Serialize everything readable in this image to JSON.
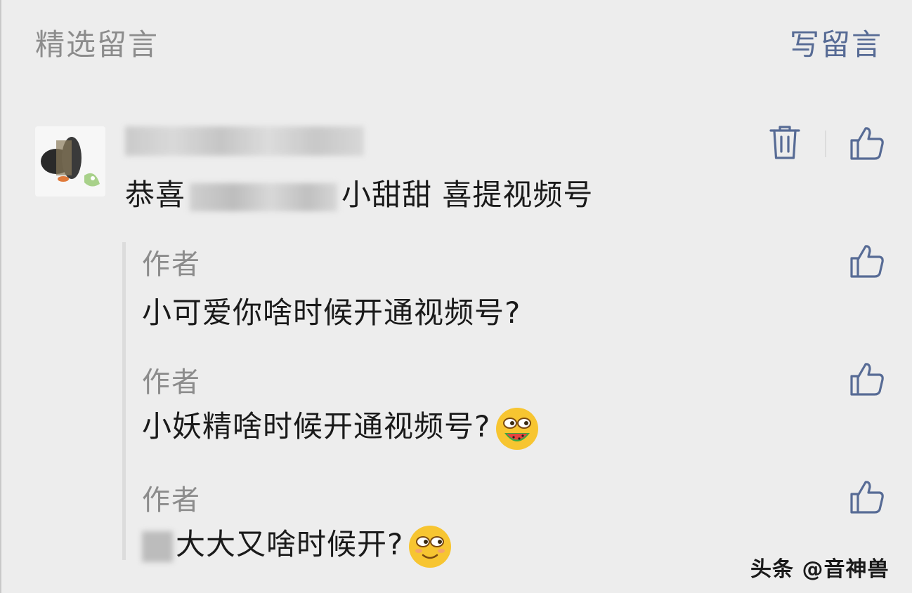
{
  "header": {
    "title": "精选留言",
    "write_link": "写留言"
  },
  "comment": {
    "text_before": "恭喜",
    "text_after": "小甜甜 喜提视频号"
  },
  "replies": [
    {
      "author": "作者",
      "text": "小可爱你啥时候开通视频号?"
    },
    {
      "author": "作者",
      "text": "小妖精啥时候开通视频号?"
    },
    {
      "author": "作者",
      "text": "大大又啥时候开?"
    }
  ],
  "watermark": "头条 @音神兽",
  "colors": {
    "background": "#ededed",
    "link": "#576b95",
    "muted": "#8c8c8c",
    "icon": "#576b95"
  },
  "icons": [
    "trash-icon",
    "thumbs-up-icon",
    "watermelon-emoji-icon",
    "smirk-emoji-icon"
  ]
}
